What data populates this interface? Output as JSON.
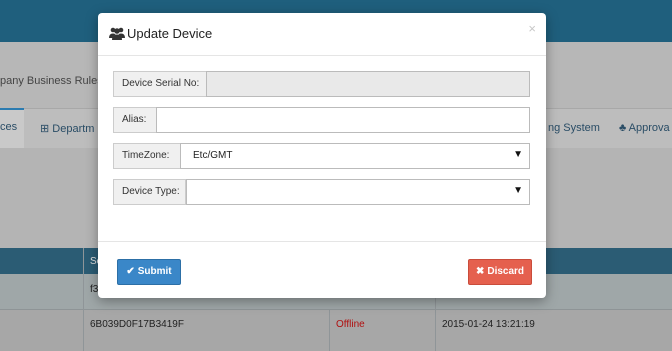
{
  "background": {
    "sub_header_text": "pany Business Rules",
    "tabs": [
      {
        "label": "ces"
      },
      {
        "label": "Departm",
        "icon": "plus-square-icon"
      },
      {
        "label": "ng System"
      },
      {
        "label": "Approva",
        "icon": "sitemap-icon"
      }
    ],
    "table": {
      "header_fragment": "Se",
      "rows": [
        {
          "serial": "f3"
        },
        {
          "serial": "6B039D0F17B3419F",
          "status": "Offline",
          "timestamp": "2015-01-24 13:21:19"
        }
      ]
    }
  },
  "modal": {
    "title": "Update Device",
    "title_icon": "users-icon",
    "close_label": "×",
    "fields": {
      "serial": {
        "label": "Device Serial No:",
        "value": ""
      },
      "alias": {
        "label": "Alias:",
        "value": ""
      },
      "timezone": {
        "label": "TimeZone:",
        "value": "Etc/GMT"
      },
      "device_type": {
        "label": "Device Type:",
        "value": ""
      }
    },
    "buttons": {
      "submit": {
        "label": "Submit",
        "icon": "check-icon"
      },
      "discard": {
        "label": "Discard",
        "icon": "x-icon"
      }
    }
  },
  "colors": {
    "submit": "#3a87c8",
    "discard": "#e5604e",
    "offline": "#b01010"
  }
}
